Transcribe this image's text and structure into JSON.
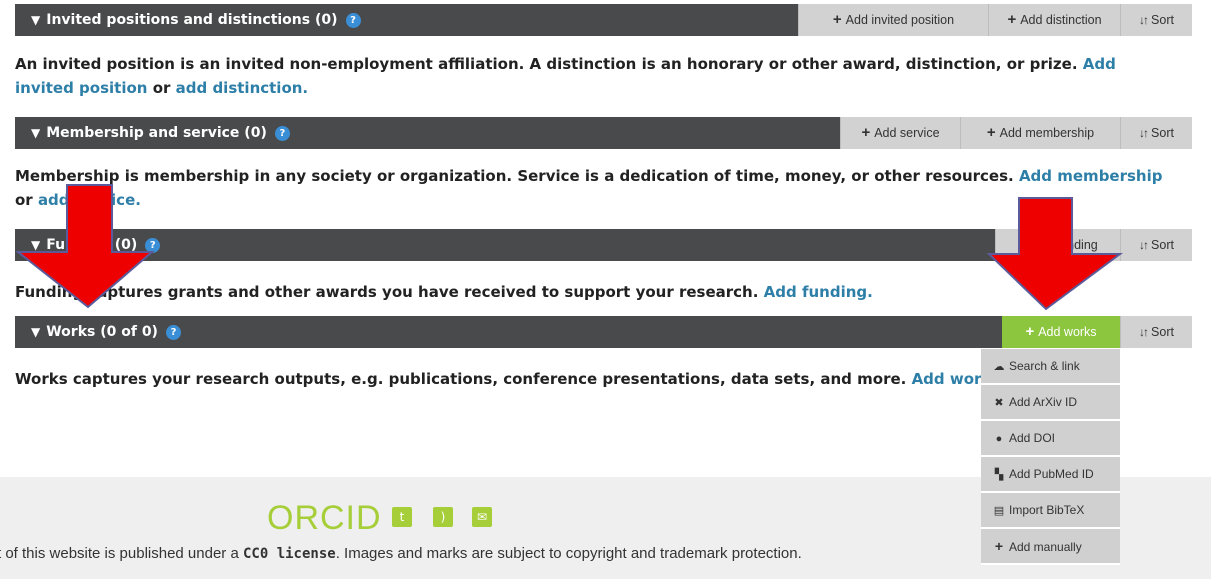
{
  "invited": {
    "title": "Invited positions and distinctions (0)",
    "btn_add_position": "Add invited position",
    "btn_add_distinction": "Add distinction",
    "btn_sort": "Sort",
    "desc": "An invited position is an invited non-employment affiliation. A distinction is an honorary or other award, distinction, or prize.",
    "link_position": "Add invited position",
    "link_or": "or",
    "link_distinction": "add distinction."
  },
  "membership": {
    "title": "Membership and service (0)",
    "btn_add_service": "Add service",
    "btn_add_membership": "Add membership",
    "btn_sort": "Sort",
    "desc": "Membership is membership in any society or organization. Service is a dedication of time, money, or other resources.",
    "link_membership": "Add membership",
    "link_or": "or",
    "link_service": "add service."
  },
  "funding": {
    "title": "Funding (0)",
    "btn_add_funding": "Add funding",
    "btn_sort": "Sort",
    "desc": "Funding captures grants and other awards you have received to support your research.",
    "link_funding": "Add funding."
  },
  "works": {
    "title": "Works (0 of 0)",
    "btn_add_works": "Add works",
    "btn_sort": "Sort",
    "desc": "Works captures your research outputs, e.g. publications, conference presentations, data sets, and more.",
    "link_works": "Add works"
  },
  "works_menu": [
    {
      "label": "Search & link",
      "icon": "cloud-upload-icon"
    },
    {
      "label": "Add ArXiv ID",
      "icon": "arxiv-icon"
    },
    {
      "label": "Add DOI",
      "icon": "doi-icon"
    },
    {
      "label": "Add PubMed ID",
      "icon": "pubmed-icon"
    },
    {
      "label": "Import BibTeX",
      "icon": "bibtex-icon"
    },
    {
      "label": "Add manually",
      "icon": "plus-icon"
    }
  ],
  "footer": {
    "logo_text": "ORCID",
    "license_prefix": "t of this website is published under a ",
    "license_name": "CC0 license",
    "license_suffix": ". Images and marks are subject to copyright and trademark protection."
  },
  "colors": {
    "bar_bg": "#494a4c",
    "button_bg": "#d2d2d2",
    "accent_green": "#8cc63f",
    "link_blue": "#2e7fa8",
    "arrow_red": "#ee0000"
  }
}
